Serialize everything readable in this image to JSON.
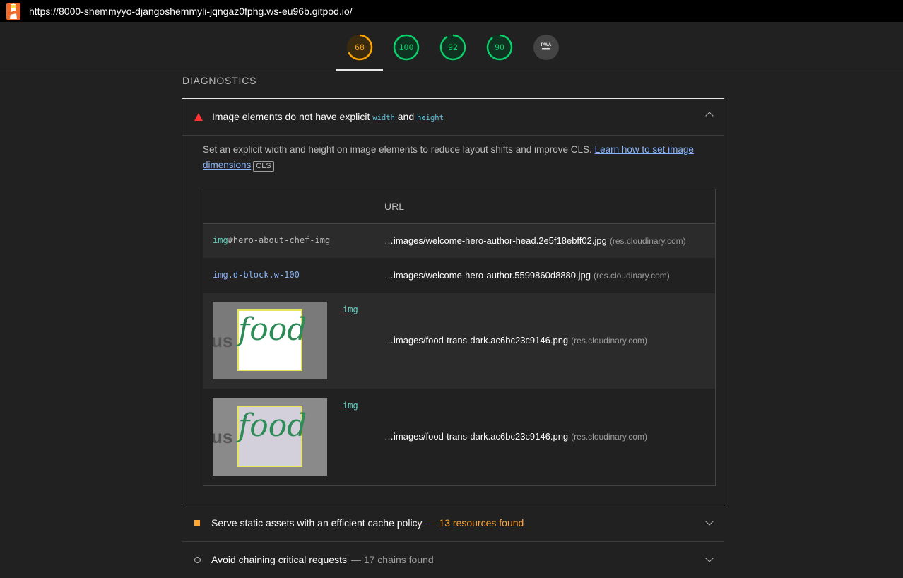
{
  "topbar": {
    "url": "https://8000-shemmyyo-djangoshemmyli-jqngaz0fphg.ws-eu96b.gitpod.io/",
    "icon": "lighthouse-icon"
  },
  "gauges": [
    {
      "label": "68",
      "score": 68,
      "color": "#ffa400"
    },
    {
      "label": "100",
      "score": 100,
      "color": "#0cce6b"
    },
    {
      "label": "92",
      "score": 92,
      "color": "#0cce6b"
    },
    {
      "label": "90",
      "score": 90,
      "color": "#0cce6b"
    },
    {
      "label": "PWA",
      "icon": "pwa-icon"
    }
  ],
  "diagnostics": {
    "section_title": "DIAGNOSTICS",
    "open_audit": {
      "title_prefix": "Image elements do not have explicit ",
      "code1": "width",
      "and": " and ",
      "code2": "height",
      "description": "Set an explicit width and height on image elements to reduce layout shifts and improve CLS. ",
      "link_text": "Learn how to set image dimensions",
      "badge": "CLS",
      "table": {
        "column_header": "URL",
        "rows": [
          {
            "el_tag": "img",
            "el_rest": "#hero-about-chef-img",
            "url": "…images/welcome-hero-author-head.2e5f18ebff02.jpg",
            "host": "(res.cloudinary.com)"
          },
          {
            "el_tag": "",
            "el_rest": "img.d-block.w-100",
            "url": "…images/welcome-hero-author.5599860d8880.jpg",
            "host": "(res.cloudinary.com)"
          },
          {
            "el_tag": "img",
            "thumb_text": "food",
            "thumb_left": "us",
            "url": "…images/food-trans-dark.ac6bc23c9146.png",
            "host": "(res.cloudinary.com)"
          },
          {
            "el_tag": "img",
            "thumb_text": "food",
            "thumb_left": "us",
            "url": "…images/food-trans-dark.ac6bc23c9146.png",
            "host": "(res.cloudinary.com)"
          }
        ]
      }
    },
    "closed_audits": [
      {
        "title": "Serve static assets with an efficient cache policy",
        "detail": "— 13 resources found",
        "detail_color": "#ffa733",
        "icon": "average-square-icon"
      },
      {
        "title": "Avoid chaining critical requests",
        "detail": "— 17 chains found",
        "detail_color": "#9e9e9e",
        "icon": "info-circle-icon"
      }
    ]
  }
}
